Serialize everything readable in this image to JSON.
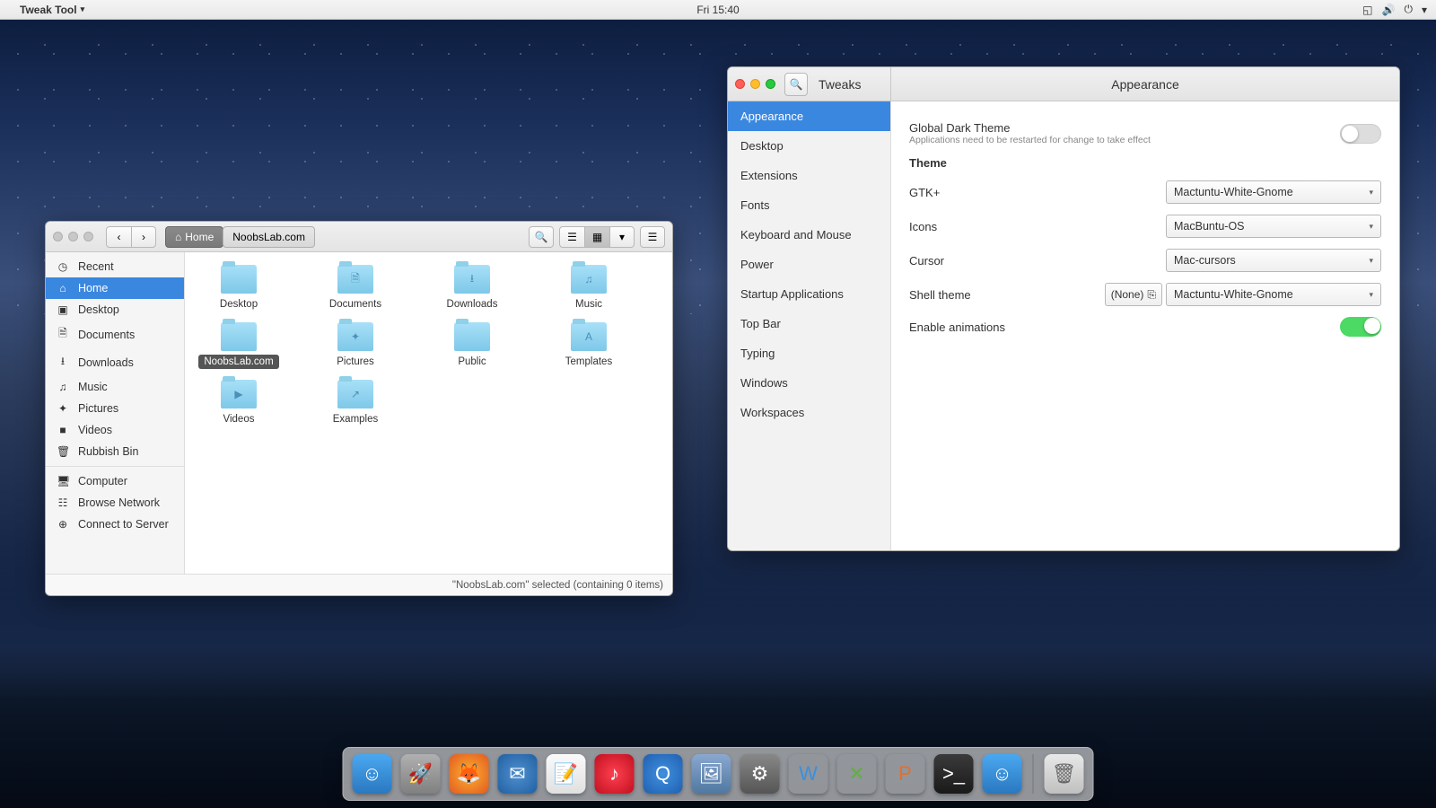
{
  "topbar": {
    "app_name": "Tweak Tool",
    "clock": "Fri 15:40"
  },
  "files": {
    "path": {
      "root": "Home",
      "current": "NoobsLab.com"
    },
    "sidebar": [
      {
        "icon": "◷",
        "label": "Recent"
      },
      {
        "icon": "⌂",
        "label": "Home",
        "active": true
      },
      {
        "icon": "▣",
        "label": "Desktop"
      },
      {
        "icon": "🗎",
        "label": "Documents"
      },
      {
        "icon": "⭳",
        "label": "Downloads"
      },
      {
        "icon": "♫",
        "label": "Music"
      },
      {
        "icon": "✦",
        "label": "Pictures"
      },
      {
        "icon": "■",
        "label": "Videos"
      },
      {
        "icon": "🗑",
        "label": "Rubbish Bin"
      },
      {
        "icon": "—",
        "label": "sep"
      },
      {
        "icon": "🖥",
        "label": "Computer"
      },
      {
        "icon": "☷",
        "label": "Browse Network"
      },
      {
        "icon": "⊕",
        "label": "Connect to Server"
      }
    ],
    "folders": [
      {
        "label": "Desktop",
        "overlay": ""
      },
      {
        "label": "Documents",
        "overlay": "🗎"
      },
      {
        "label": "Downloads",
        "overlay": "⭳"
      },
      {
        "label": "Music",
        "overlay": "♫"
      },
      {
        "label": "NoobsLab.com",
        "overlay": "",
        "selected": true
      },
      {
        "label": "Pictures",
        "overlay": "✦"
      },
      {
        "label": "Public",
        "overlay": ""
      },
      {
        "label": "Templates",
        "overlay": "A"
      },
      {
        "label": "Videos",
        "overlay": "▶"
      },
      {
        "label": "Examples",
        "overlay": "↗"
      }
    ],
    "status": "\"NoobsLab.com\" selected  (containing 0 items)"
  },
  "tweaks": {
    "title_left": "Tweaks",
    "title_center": "Appearance",
    "sidebar": [
      {
        "label": "Appearance",
        "active": true
      },
      {
        "label": "Desktop"
      },
      {
        "label": "Extensions"
      },
      {
        "label": "Fonts"
      },
      {
        "label": "Keyboard and Mouse"
      },
      {
        "label": "Power"
      },
      {
        "label": "Startup Applications"
      },
      {
        "label": "Top Bar"
      },
      {
        "label": "Typing"
      },
      {
        "label": "Windows"
      },
      {
        "label": "Workspaces"
      }
    ],
    "global_dark": {
      "label": "Global Dark Theme",
      "sub": "Applications need to be restarted for change to take effect",
      "value": false
    },
    "theme_heading": "Theme",
    "gtk": {
      "label": "GTK+",
      "value": "Mactuntu-White-Gnome"
    },
    "icons": {
      "label": "Icons",
      "value": "MacBuntu-OS"
    },
    "cursor": {
      "label": "Cursor",
      "value": "Mac-cursors"
    },
    "shell": {
      "label": "Shell theme",
      "reset": "(None)",
      "value": "Mactuntu-White-Gnome"
    },
    "animations": {
      "label": "Enable animations",
      "value": true
    }
  },
  "dock": {
    "items": [
      {
        "name": "finder",
        "bg": "linear-gradient(to bottom,#4aa8f0,#2a78c0)",
        "glyph": "☺"
      },
      {
        "name": "launchpad",
        "bg": "linear-gradient(to bottom,#b0b0b0,#808080)",
        "glyph": "🚀"
      },
      {
        "name": "firefox",
        "bg": "radial-gradient(circle,#ffb030,#e05a20)",
        "glyph": "🦊"
      },
      {
        "name": "thunderbird",
        "bg": "radial-gradient(circle,#5090d0,#2060a0)",
        "glyph": "✉"
      },
      {
        "name": "textedit",
        "bg": "linear-gradient(to bottom,#fafafa,#e0e0e0)",
        "glyph": "📝"
      },
      {
        "name": "itunes",
        "bg": "radial-gradient(circle,#ff4050,#c01020)",
        "glyph": "♪"
      },
      {
        "name": "quicktime",
        "bg": "radial-gradient(circle,#4090e0,#2060b0)",
        "glyph": "Q"
      },
      {
        "name": "photos",
        "bg": "linear-gradient(to bottom,#8aa8d0,#5078a0)",
        "glyph": "🖼"
      },
      {
        "name": "settings",
        "bg": "linear-gradient(to bottom,#888,#555)",
        "glyph": "⚙"
      },
      {
        "name": "wps-writer",
        "bg": "transparent",
        "glyph": "W",
        "color": "#3a90e0"
      },
      {
        "name": "wps-spreadsheet",
        "bg": "transparent",
        "glyph": "✕",
        "color": "#60b040"
      },
      {
        "name": "wps-presentation",
        "bg": "transparent",
        "glyph": "P",
        "color": "#e07030"
      },
      {
        "name": "terminal",
        "bg": "linear-gradient(to bottom,#3a3a3a,#1a1a1a)",
        "glyph": ">_"
      },
      {
        "name": "finder2",
        "bg": "linear-gradient(to bottom,#4aa8f0,#2a78c0)",
        "glyph": "☺"
      }
    ],
    "trash": {
      "name": "trash",
      "bg": "linear-gradient(to bottom,#e8e8e8,#c0c0c0)",
      "glyph": "🗑"
    }
  }
}
